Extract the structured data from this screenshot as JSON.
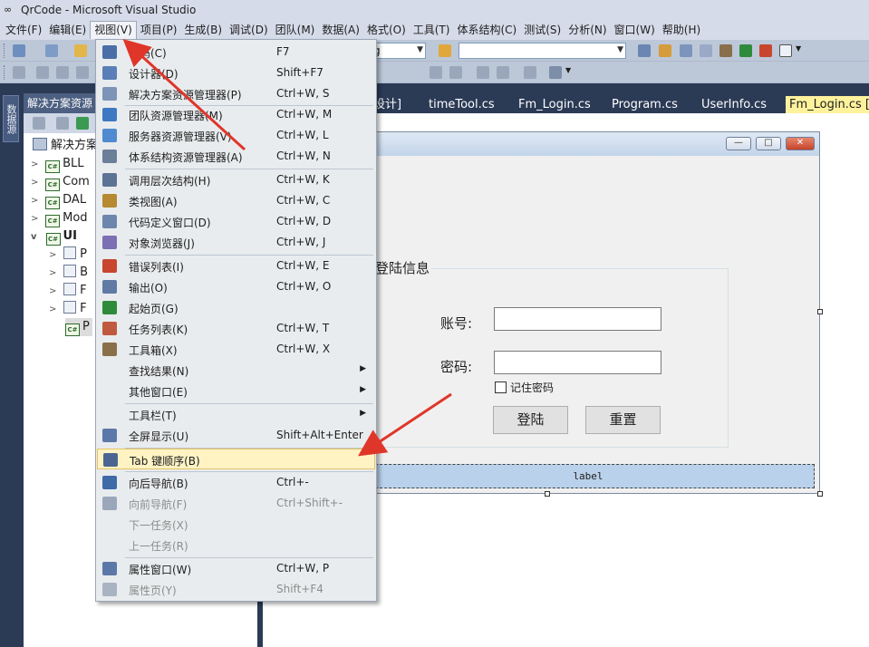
{
  "window": {
    "title": "QrCode - Microsoft Visual Studio"
  },
  "menubar": [
    "文件(F)",
    "编辑(E)",
    "视图(V)",
    "项目(P)",
    "生成(B)",
    "调试(D)",
    "团队(M)",
    "数据(A)",
    "格式(O)",
    "工具(T)",
    "体系结构(C)",
    "测试(S)",
    "分析(N)",
    "窗口(W)",
    "帮助(H)"
  ],
  "toolbar": {
    "combo1_value": "g",
    "combo2_value": ""
  },
  "side_tab": "数据源",
  "solution_explorer": {
    "title": "解决方案资源",
    "solution_label": "解决方案",
    "projects": [
      "BLL",
      "Com",
      "DAL",
      "Mod",
      "UI"
    ],
    "ui_children": [
      "P",
      "B",
      "F",
      "F",
      "P"
    ]
  },
  "doc_tabs": [
    "设计]",
    "timeTool.cs",
    "Fm_Login.cs",
    "Program.cs",
    "UserInfo.cs",
    "Fm_Login.cs [设"
  ],
  "form": {
    "group_title": "登陆信息",
    "account_label": "账号:",
    "password_label": "密码:",
    "remember_label": "记住密码",
    "login_button": "登陆",
    "reset_button": "重置",
    "status_label": "label"
  },
  "view_menu": {
    "items": [
      {
        "label": "代码(C)",
        "shortcut": "F7",
        "icon": "code-icon",
        "color": "#4b6ea8"
      },
      {
        "label": "设计器(D)",
        "shortcut": "Shift+F7",
        "icon": "designer-icon",
        "color": "#5a7fb8"
      },
      {
        "label": "解决方案资源管理器(P)",
        "shortcut": "Ctrl+W, S",
        "icon": "solution-explorer-icon",
        "color": "#7d93b8"
      },
      {
        "label": "团队资源管理器(M)",
        "shortcut": "Ctrl+W, M",
        "icon": "team-explorer-icon",
        "color": "#3e78c2"
      },
      {
        "label": "服务器资源管理器(V)",
        "shortcut": "Ctrl+W, L",
        "icon": "server-explorer-icon",
        "color": "#4f8bd0"
      },
      {
        "label": "体系结构资源管理器(A)",
        "shortcut": "Ctrl+W, N",
        "icon": "architecture-explorer-icon",
        "color": "#6c7f9a"
      },
      {
        "label": "调用层次结构(H)",
        "shortcut": "Ctrl+W, K",
        "icon": "call-hierarchy-icon",
        "color": "#5d7396"
      },
      {
        "label": "类视图(A)",
        "shortcut": "Ctrl+W, C",
        "icon": "class-view-icon",
        "color": "#b58a32"
      },
      {
        "label": "代码定义窗口(D)",
        "shortcut": "Ctrl+W, D",
        "icon": "code-definition-icon",
        "color": "#6d86ad"
      },
      {
        "label": "对象浏览器(J)",
        "shortcut": "Ctrl+W, J",
        "icon": "object-browser-icon",
        "color": "#7c6fb3"
      },
      {
        "label": "错误列表(I)",
        "shortcut": "Ctrl+W, E",
        "icon": "error-list-icon",
        "color": "#c8452e"
      },
      {
        "label": "输出(O)",
        "shortcut": "Ctrl+W, O",
        "icon": "output-icon",
        "color": "#5f7aa4"
      },
      {
        "label": "起始页(G)",
        "shortcut": "",
        "icon": "start-page-icon",
        "color": "#2e8b3c"
      },
      {
        "label": "任务列表(K)",
        "shortcut": "Ctrl+W, T",
        "icon": "task-list-icon",
        "color": "#c05a3e"
      },
      {
        "label": "工具箱(X)",
        "shortcut": "Ctrl+W, X",
        "icon": "toolbox-icon",
        "color": "#8a6f4b"
      },
      {
        "label": "查找结果(N)",
        "shortcut": "",
        "submenu": true
      },
      {
        "label": "其他窗口(E)",
        "shortcut": "",
        "submenu": true
      },
      {
        "label": "工具栏(T)",
        "shortcut": "",
        "submenu": true
      },
      {
        "label": "全屏显示(U)",
        "shortcut": "Shift+Alt+Enter",
        "icon": "full-screen-icon",
        "color": "#5c78a8"
      },
      {
        "label": "Tab 键顺序(B)",
        "shortcut": "",
        "icon": "tab-order-icon",
        "color": "#4d6691",
        "highlight": true
      },
      {
        "label": "向后导航(B)",
        "shortcut": "Ctrl+-",
        "icon": "navigate-back-icon",
        "color": "#3f6aa8"
      },
      {
        "label": "向前导航(F)",
        "shortcut": "Ctrl+Shift+-",
        "icon": "navigate-forward-icon",
        "color": "#9aa7bb",
        "disabled": true
      },
      {
        "label": "下一任务(X)",
        "shortcut": "",
        "disabled": true
      },
      {
        "label": "上一任务(R)",
        "shortcut": "",
        "disabled": true
      },
      {
        "label": "属性窗口(W)",
        "shortcut": "Ctrl+W, P",
        "icon": "properties-window-icon",
        "color": "#5c78a8"
      },
      {
        "label": "属性页(Y)",
        "shortcut": "Shift+F4",
        "icon": "property-pages-icon",
        "color": "#a9b3c2",
        "disabled": true
      }
    ]
  },
  "colors": {
    "highlight": "#fff3c4",
    "arrow": "#e0362a",
    "ide_dark": "#2b3a55",
    "active_tab": "#fff29d"
  }
}
